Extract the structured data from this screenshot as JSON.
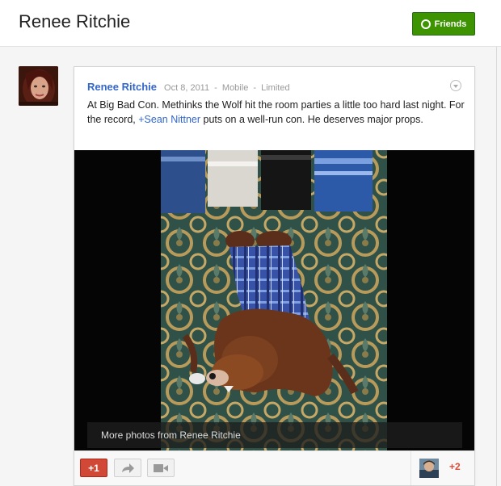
{
  "header": {
    "title": "Renee Ritchie",
    "friends_label": "Friends",
    "friends_color": "#3d9400"
  },
  "post": {
    "author": "Renee Ritchie",
    "date": "Oct 8, 2011",
    "separator": "-",
    "source": "Mobile",
    "visibility": "Limited",
    "text_before": "At Big Bad Con. Methinks the Wolf hit the room parties a little too hard last night. For the record, ",
    "mention": "+Sean Nittner",
    "text_after": " puts on a well-run con. He deserves major props.",
    "more_photos_label": "More photos from Renee Ritchie"
  },
  "actions": {
    "plus_one_label": "+1",
    "share_icon": "share-arrow-icon",
    "hangout_icon": "video-camera-icon",
    "plus_count": "+2"
  },
  "colors": {
    "link": "#3366cc",
    "plus_one": "#d14836",
    "plus_count": "#dd4b39"
  }
}
